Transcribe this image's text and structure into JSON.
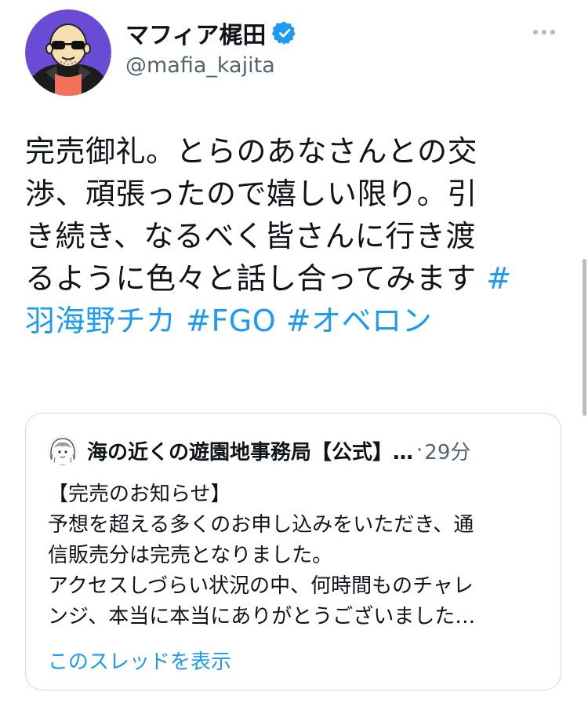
{
  "author": {
    "display_name": "マフィア梶田",
    "handle": "@mafia_kajita",
    "verified_icon": "verified-badge-icon",
    "avatar_icon": "avatar-cartoon-man-sunglasses"
  },
  "tweet": {
    "lines": [
      [
        {
          "text": "完売御礼。とらのあなさんとの交",
          "hashtag": false
        }
      ],
      [
        {
          "text": "渉、頑張ったので嬉しい限り。引",
          "hashtag": false
        }
      ],
      [
        {
          "text": "き続き、なるべく皆さんに行き渡",
          "hashtag": false
        }
      ],
      [
        {
          "text": "るように色々と話し合ってみます ",
          "hashtag": false
        },
        {
          "text": "#",
          "hashtag": true
        }
      ],
      [
        {
          "text": "羽海野チカ",
          "hashtag": true
        },
        {
          "text": " ",
          "hashtag": false
        },
        {
          "text": "#FGO",
          "hashtag": true
        },
        {
          "text": " ",
          "hashtag": false
        },
        {
          "text": "#オベロン",
          "hashtag": true
        }
      ]
    ]
  },
  "quote": {
    "name": "海の近くの遊園地事務局【公式】…",
    "separator": "·",
    "time": "29分",
    "body_lines": [
      "【完売のお知らせ】",
      "予想を超える多くのお申し込みをいただき、通",
      "信販売分は完売となりました。",
      "アクセスしづらい状況の中、何時間ものチャレ",
      "ンジ、本当に本当にありがとうございました…"
    ],
    "thread_link": "このスレッドを表示",
    "avatar_icon": "avatar-manga-character"
  },
  "more_icon": "more-horizontal-icon",
  "colors": {
    "link": "#1d9bf0",
    "secondary": "#536471",
    "text": "#0f1419",
    "border": "#cfd9de"
  }
}
